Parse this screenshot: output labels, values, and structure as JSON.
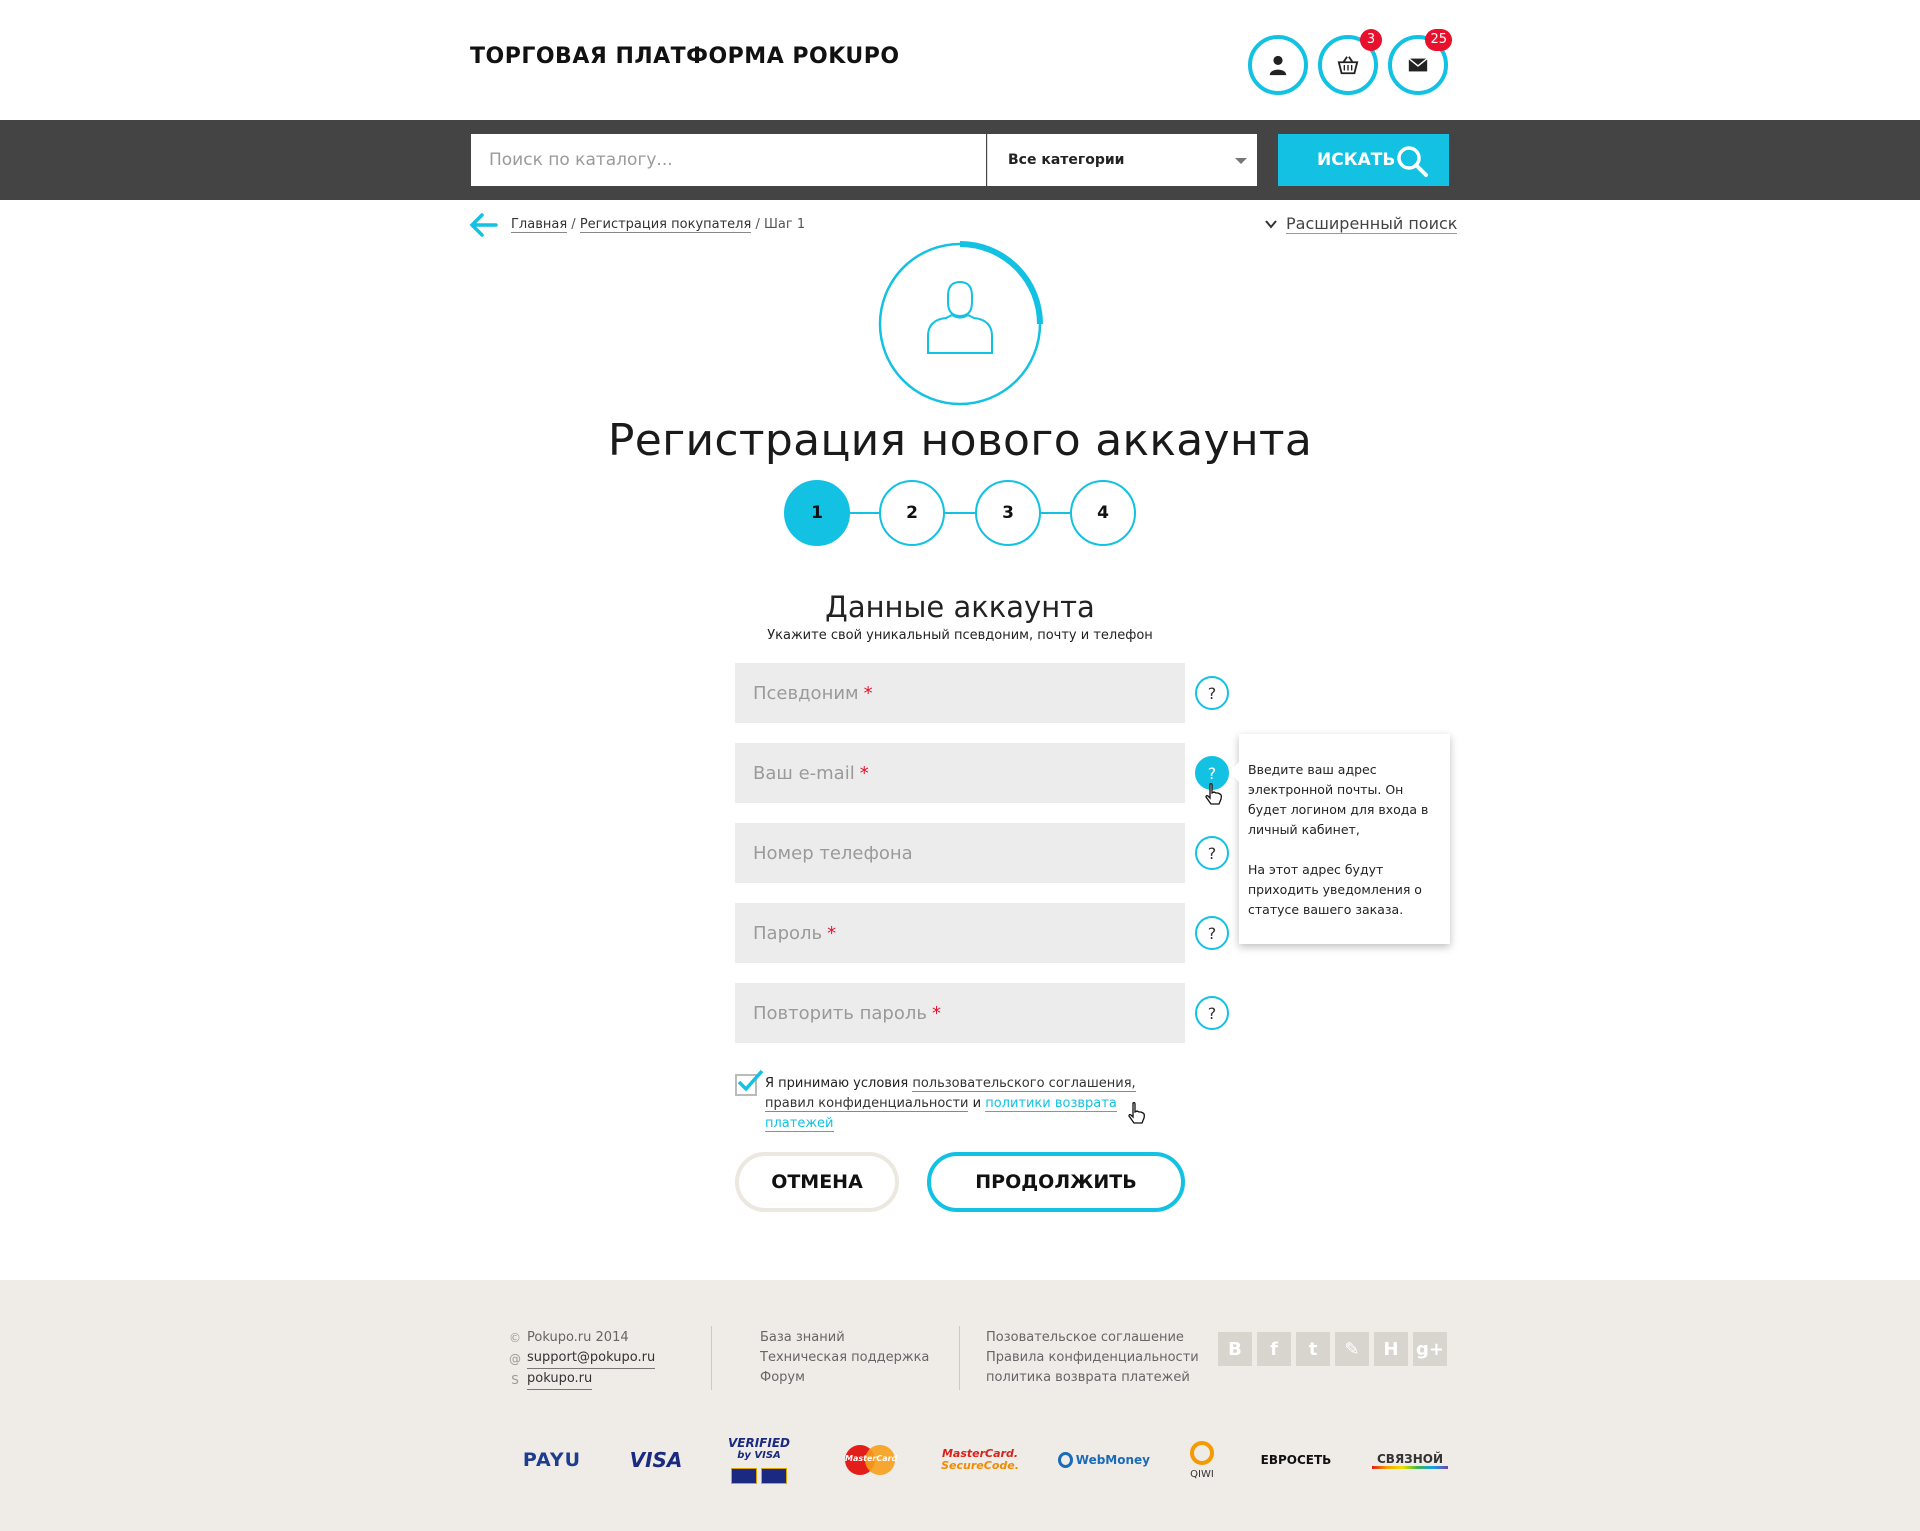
{
  "header": {
    "brand": "ТОРГОВАЯ ПЛАТФОРМА POKUPO",
    "cart_count": "3",
    "messages_count": "25"
  },
  "search": {
    "placeholder": "Поиск по каталогу...",
    "category": "Все категории",
    "button_label": "ИСКАТЬ"
  },
  "breadcrumb": {
    "home": "Главная",
    "sep1": "/",
    "registration": "Регистрация покупателя",
    "sep2": "/",
    "current": "Шаг 1"
  },
  "advanced_search": "Расширенный поиск",
  "registration": {
    "title": "Регистрация нового аккаунта",
    "steps": [
      "1",
      "2",
      "3",
      "4"
    ],
    "active_step": 1,
    "progress_fraction": 0.25
  },
  "section": {
    "title": "Данные аккаунта",
    "subtitle": "Укажите свой уникальный псевдоним, почту и телефон"
  },
  "fields": [
    {
      "placeholder": "Псевдоним",
      "required": "*"
    },
    {
      "placeholder": "Ваш e-mail",
      "required": "*"
    },
    {
      "placeholder": "Номер телефона",
      "required": ""
    },
    {
      "placeholder": "Пароль",
      "required": "*"
    },
    {
      "placeholder": "Повторить пароль",
      "required": "*"
    }
  ],
  "help_label": "?",
  "tooltip": {
    "paragraph1": "Введите ваш адрес электронной почты. Он будет логином для входа в личный кабинет,",
    "paragraph2": "На этот адрес будут приходить уведомления о статусе вашего заказа."
  },
  "agreement": {
    "checked": true,
    "text1": "Я принимаю условия ",
    "link1": "пользовательского соглашения,",
    "link2": "правил конфиденциальности",
    "text2": " и ",
    "link3": "политики возврата платежей"
  },
  "buttons": {
    "cancel": "ОТМЕНА",
    "continue": "ПРОДОЛЖИТЬ"
  },
  "footer": {
    "copyright": "Pokupo.ru 2014",
    "email": "support@pokupo.ru",
    "skype": "pokupo.ru",
    "col2": [
      "База знаний",
      "Техническая поддержка",
      "Форум"
    ],
    "col3": [
      "Позовательское соглашение",
      "Правила конфиденциальности",
      "политика возврата платежей"
    ],
    "social": [
      "В",
      "f",
      "t",
      "✎",
      "Н",
      "g+"
    ],
    "payments": {
      "payu": "PAYU",
      "visa": "VISA",
      "verified_line1": "VERIFIED",
      "verified_line2": "by VISA",
      "mastercard": "MasterCard",
      "mc_secure1": "MasterCard.",
      "mc_secure2": "SecureCode.",
      "webmoney": "WebMoney",
      "qiwi": "QIWI",
      "euroset": "ЕВРОСЕТЬ",
      "svyaznoy": "СВЯЗНОЙ"
    }
  },
  "colors": {
    "accent": "#13c1e3",
    "dark_bar": "#444444",
    "required": "#e8102d",
    "footer_bg": "#efebe6"
  }
}
